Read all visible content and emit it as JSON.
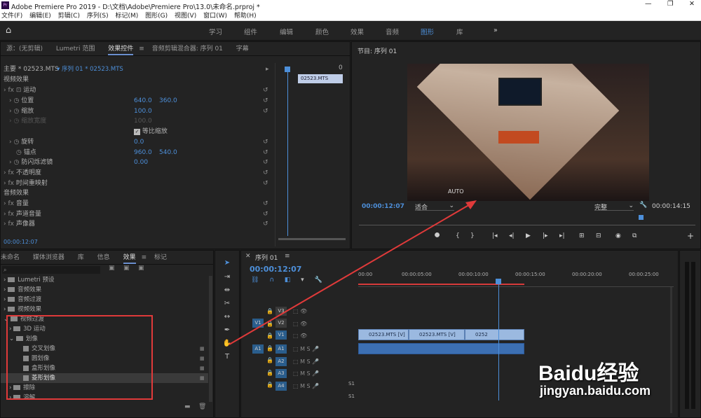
{
  "window": {
    "title": "Adobe Premiere Pro 2019 - D:\\文档\\Adobe\\Premiere Pro\\13.0\\未命名.prproj *"
  },
  "menu": [
    "文件(F)",
    "编辑(E)",
    "剪辑(C)",
    "序列(S)",
    "标记(M)",
    "图形(G)",
    "视图(V)",
    "窗口(W)",
    "帮助(H)"
  ],
  "workspaces": [
    "学习",
    "组件",
    "编辑",
    "颜色",
    "效果",
    "音频",
    "图形",
    "库"
  ],
  "workspace_active": "图形",
  "left_tabs": [
    "源：(无剪辑)",
    "Lumetri 范围",
    "效果控件",
    "音频剪辑混合器: 序列 01",
    "字幕"
  ],
  "effect_controls": {
    "master": "主要 * 02523.MTS",
    "sequence": "序列 01 * 02523.MTS",
    "video_section": "视频效果",
    "clip_name": "02523.MTS",
    "timecode_zero": "0",
    "rows": [
      {
        "label": "运动",
        "v1": "",
        "v2": ""
      },
      {
        "label": "位置",
        "v1": "640.0",
        "v2": "360.0"
      },
      {
        "label": "缩放",
        "v1": "100.0",
        "v2": ""
      },
      {
        "label": "缩放宽度",
        "v1": "100.0",
        "v2": ""
      },
      {
        "label": "等比缩放",
        "v1": "",
        "v2": ""
      },
      {
        "label": "旋转",
        "v1": "0.0",
        "v2": ""
      },
      {
        "label": "锚点",
        "v1": "960.0",
        "v2": "540.0"
      },
      {
        "label": "防闪烁滤镜",
        "v1": "0.00",
        "v2": ""
      },
      {
        "label": "不透明度",
        "v1": "",
        "v2": ""
      },
      {
        "label": "时间重映射",
        "v1": "",
        "v2": ""
      }
    ],
    "audio_section": "音频效果",
    "audio_rows": [
      "音量",
      "声道音量",
      "声像器"
    ],
    "timecode": "00:00:12:07"
  },
  "program": {
    "title": "节目: 序列 01",
    "timecode": "00:00:12:07",
    "fit": "适合",
    "quality": "完整",
    "duration": "00:00:14:15",
    "auto_text": "AUTO"
  },
  "project_tabs": [
    "未命名",
    "媒体浏览器",
    "库",
    "信息",
    "效果",
    "标记"
  ],
  "effects_tree": [
    "Lumetri 预设",
    "音频效果",
    "音频过渡",
    "视频效果",
    "视频过渡",
    "3D 运动",
    "划像",
    "交叉划像",
    "圆划像",
    "盒形划像",
    "菱形划像",
    "擦除",
    "溶解"
  ],
  "timeline": {
    "title": "序列 01",
    "timecode": "00:00:12:07",
    "ruler": [
      "00:00",
      "00:00:05:00",
      "00:00:10:00",
      "00:00:15:00",
      "00:00:20:00",
      "00:00:25:00"
    ],
    "tracks": [
      "V3",
      "V2",
      "V1",
      "A1",
      "A2",
      "A3",
      "A4"
    ],
    "src_v1": "V1",
    "src_a1": "A1",
    "clips": [
      "02523.MTS [V]",
      "02523.MTS [V]",
      "0252"
    ],
    "mix": "S1",
    "mix2": "S1"
  },
  "watermark": {
    "brand": "Baidu经验",
    "url": "jingyan.baidu.com"
  },
  "colors": {
    "accent": "#4d8fd9",
    "highlight_box": "#e03a3a"
  }
}
